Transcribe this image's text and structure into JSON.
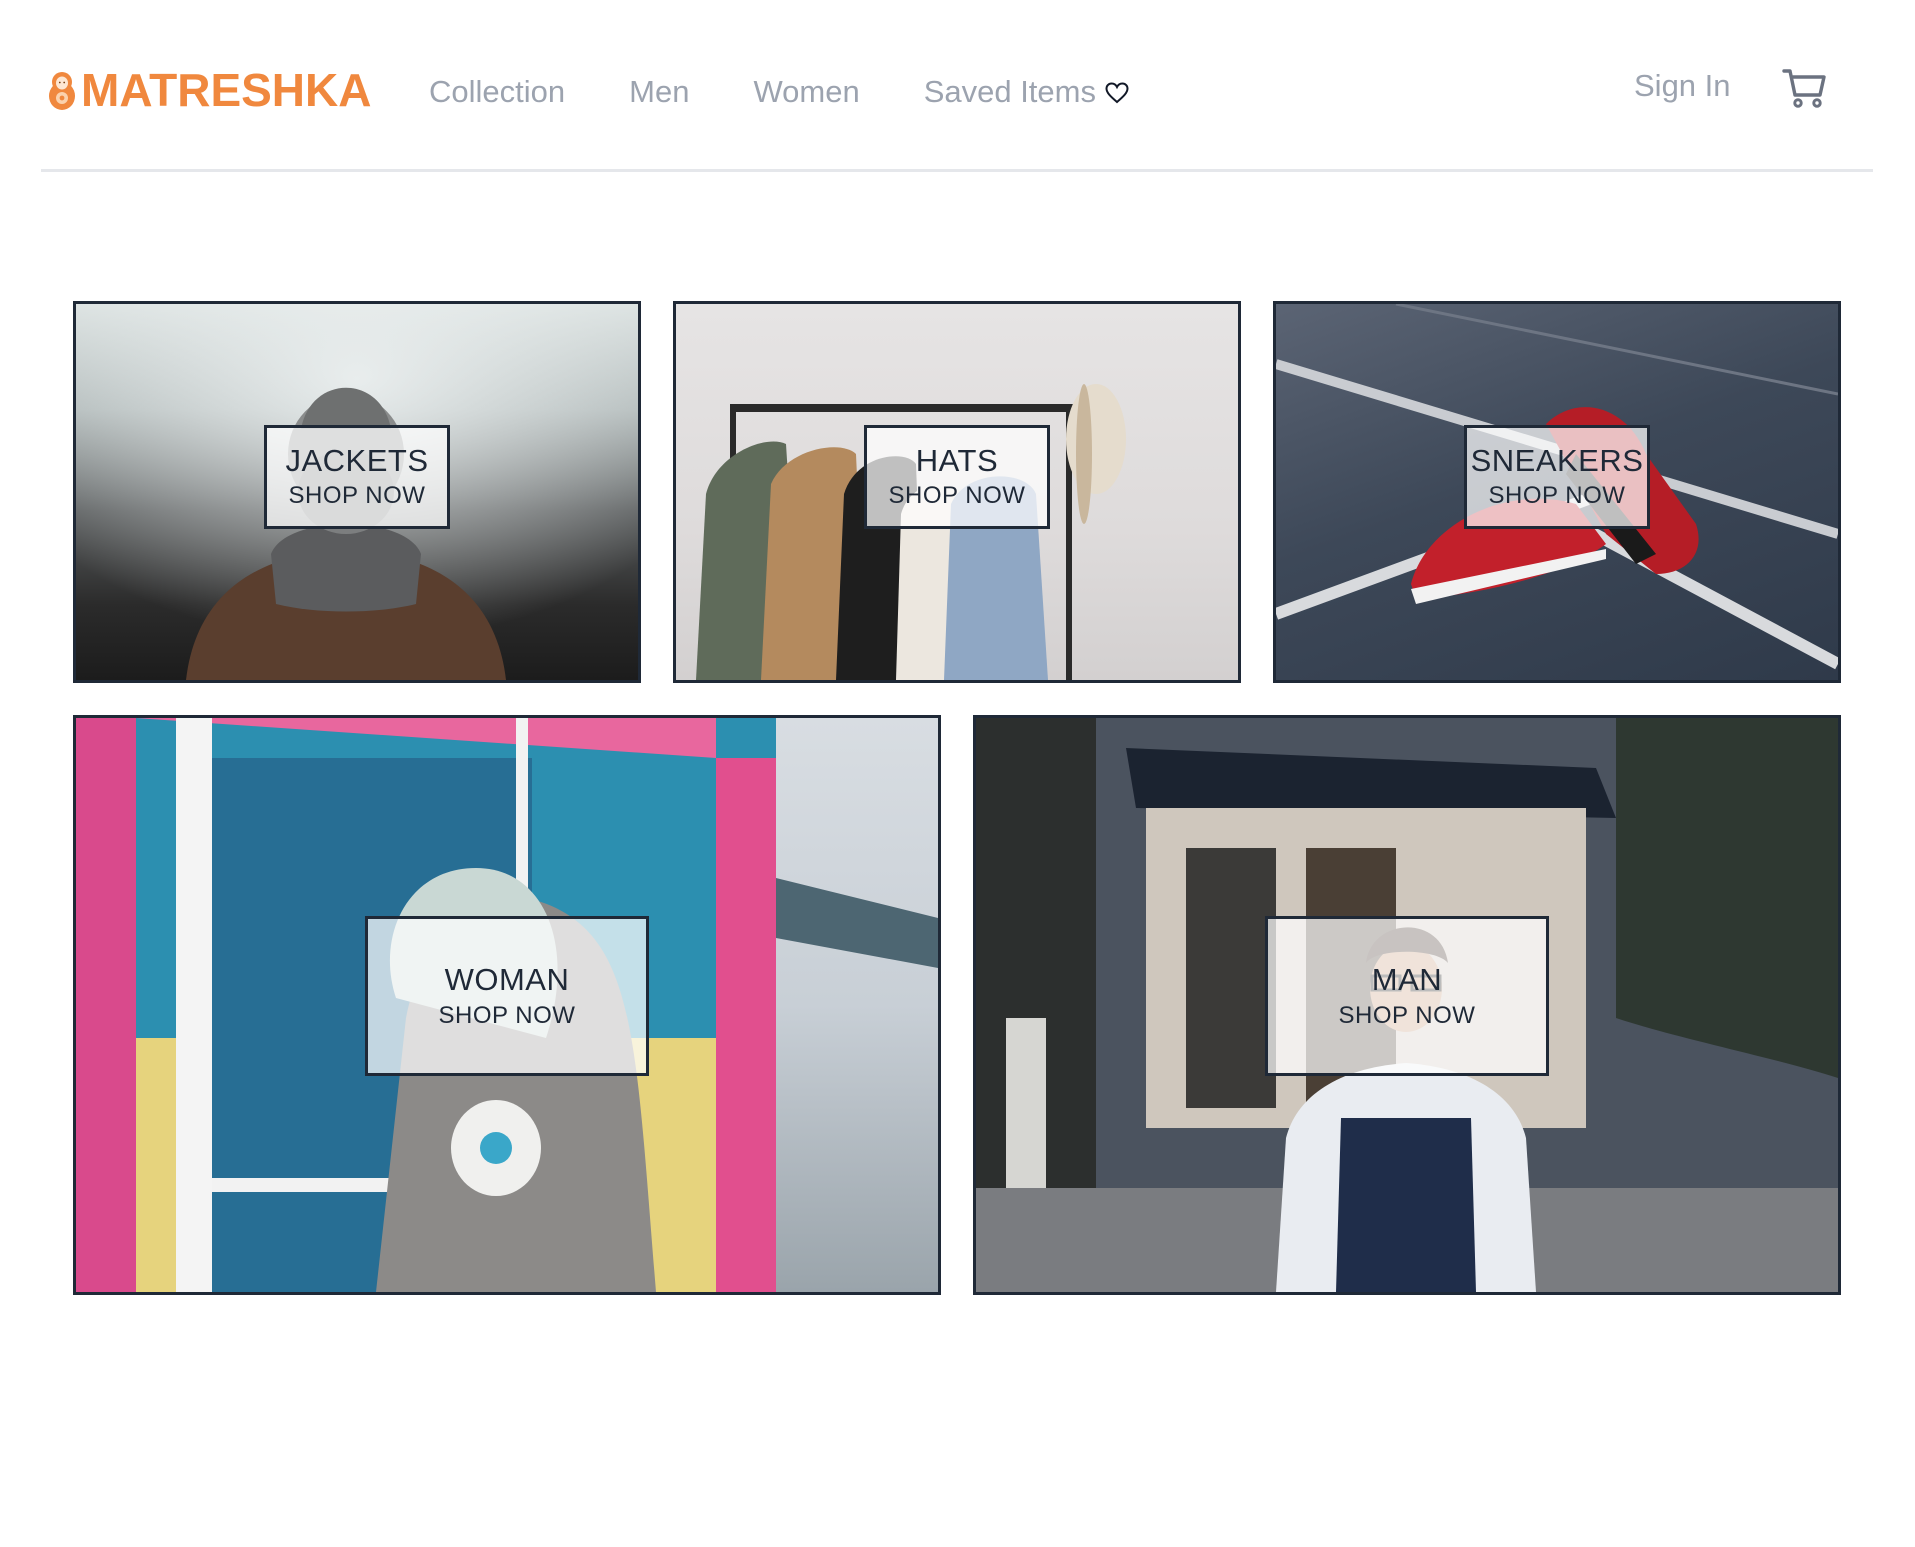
{
  "brand": {
    "name": "MATRESHKA",
    "color": "#f0883e",
    "logo_icon": "matryoshka-doll-icon"
  },
  "nav": {
    "links": [
      {
        "label": "Collection"
      },
      {
        "label": "Men"
      },
      {
        "label": "Women"
      },
      {
        "label": "Saved Items",
        "icon": "heart-icon"
      }
    ],
    "sign_in": "Sign In",
    "cart_icon": "shopping-cart-icon"
  },
  "categories": [
    {
      "title": "JACKETS",
      "cta": "SHOP NOW"
    },
    {
      "title": "HATS",
      "cta": "SHOP NOW"
    },
    {
      "title": "SNEAKERS",
      "cta": "SHOP NOW"
    },
    {
      "title": "WOMAN",
      "cta": "SHOP NOW"
    },
    {
      "title": "MAN",
      "cta": "SHOP NOW"
    }
  ],
  "colors": {
    "nav_text": "#9ca3af",
    "border": "#1f2937",
    "divider": "#e5e7eb"
  }
}
